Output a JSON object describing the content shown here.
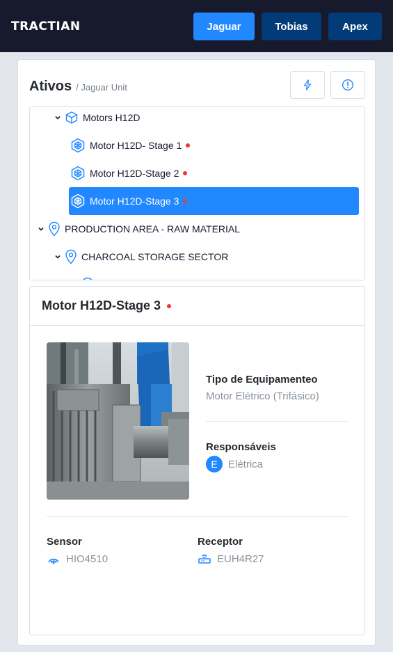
{
  "header": {
    "logo": "TRACTIAN",
    "units": [
      {
        "label": "Jaguar",
        "active": true
      },
      {
        "label": "Tobias",
        "active": false
      },
      {
        "label": "Apex",
        "active": false
      }
    ]
  },
  "assets": {
    "title": "Ativos",
    "breadcrumb": "/ Jaguar Unit",
    "filter_icons": [
      "bolt-icon",
      "alert-circle-icon"
    ]
  },
  "tree": {
    "items": [
      {
        "label": "Motors H12D",
        "type": "asset",
        "expanded": true
      },
      {
        "label": "Motor H12D- Stage 1",
        "type": "component",
        "status": "alert"
      },
      {
        "label": "Motor H12D-Stage 2",
        "type": "component",
        "status": "alert"
      },
      {
        "label": "Motor H12D-Stage 3",
        "type": "component",
        "status": "alert",
        "selected": true
      },
      {
        "label": "PRODUCTION AREA - RAW MATERIAL",
        "type": "location",
        "expanded": true
      },
      {
        "label": "CHARCOAL STORAGE SECTOR",
        "type": "location",
        "expanded": true
      }
    ]
  },
  "detail": {
    "title": "Motor H12D-Stage 3",
    "equipment_type_label": "Tipo de Equipamenteo",
    "equipment_type_value": "Motor Elétrico (Trifásico)",
    "responsibles_label": "Responsáveis",
    "responsible_initial": "E",
    "responsible_value": "Elétrica",
    "sensor_label": "Sensor",
    "sensor_value": "HIO4510",
    "receptor_label": "Receptor",
    "receptor_value": "EUH4R27"
  },
  "colors": {
    "header_bg": "#17192d",
    "primary": "#2188ff",
    "unit_inactive": "#023b78",
    "alert": "#ed3833"
  }
}
